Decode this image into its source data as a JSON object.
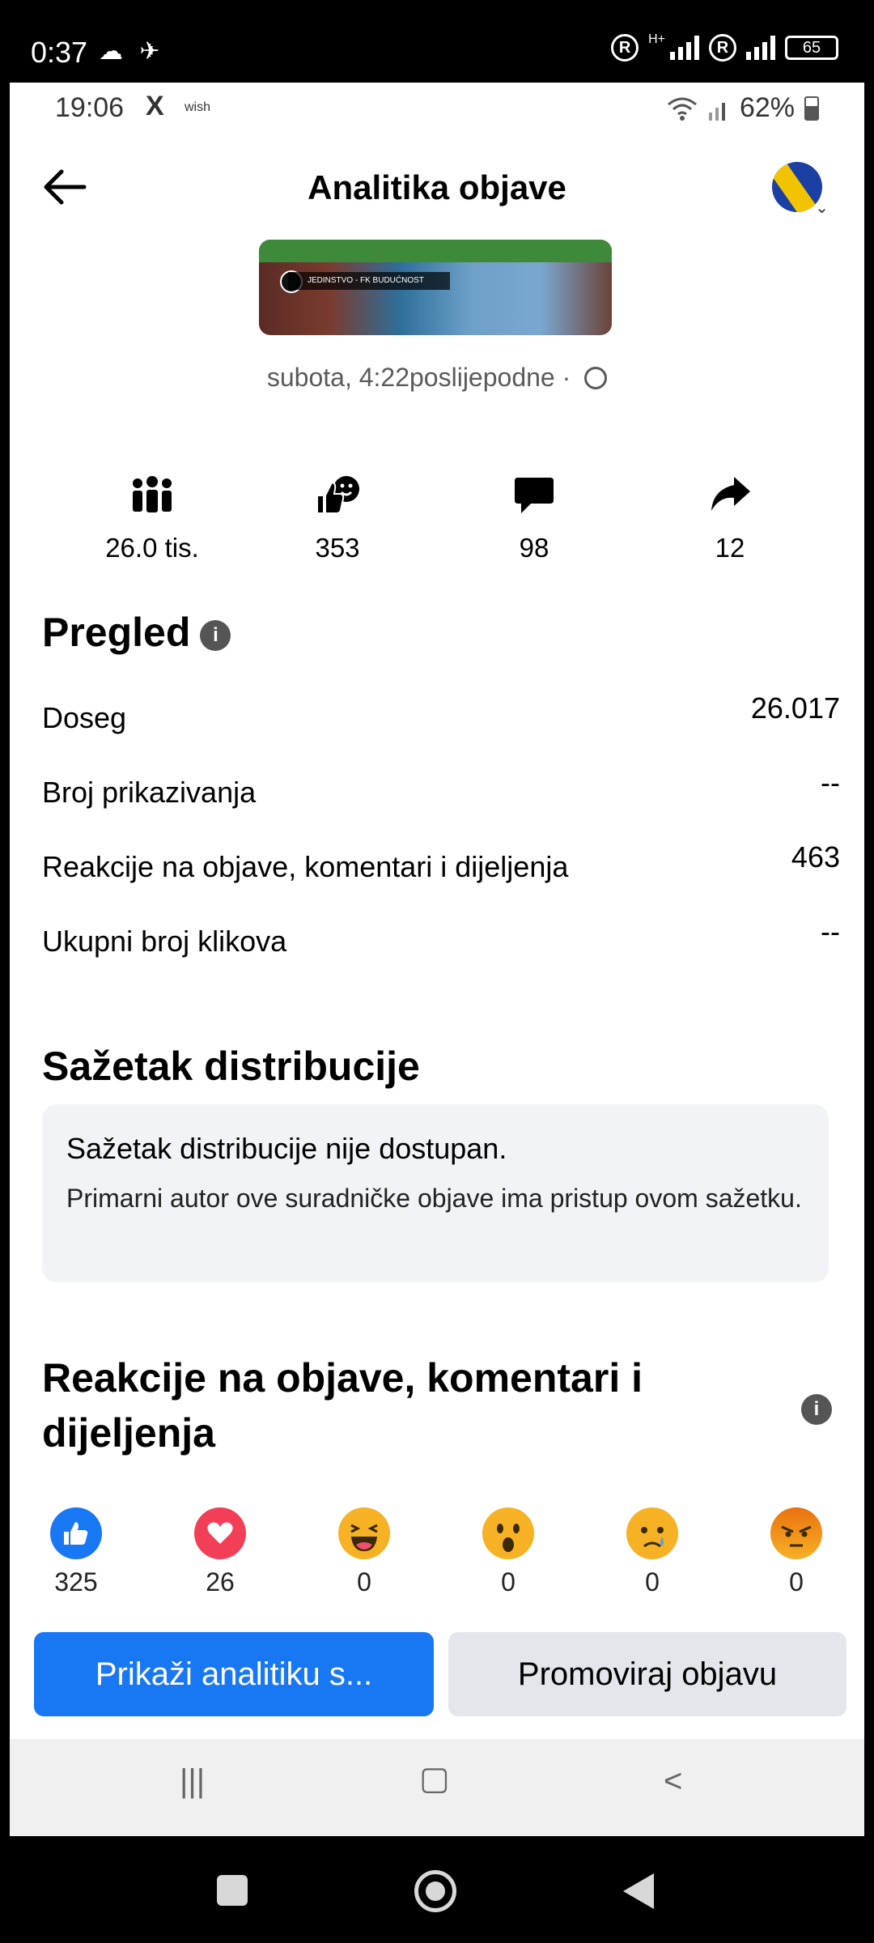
{
  "outer_status": {
    "time": "0:37",
    "battery": "65",
    "network": "H+"
  },
  "inner_status": {
    "time": "19:06",
    "x_label": "X",
    "wish_label": "wish",
    "battery": "62%"
  },
  "header": {
    "title": "Analitika objave"
  },
  "thumbnail": {
    "caption": "JEDINSTVO - FK BUDUĆNOST"
  },
  "post_meta": {
    "timestamp": "subota, 4:22poslijepodne ·"
  },
  "stats": [
    {
      "icon": "reach-people-icon",
      "value": "26.0 tis."
    },
    {
      "icon": "reactions-icon",
      "value": "353"
    },
    {
      "icon": "comment-icon",
      "value": "98"
    },
    {
      "icon": "share-icon",
      "value": "12"
    }
  ],
  "overview": {
    "title": "Pregled",
    "info": "i",
    "rows": [
      {
        "label": "Doseg",
        "value": "26.017"
      },
      {
        "label": "Broj prikazivanja",
        "value": "--"
      },
      {
        "label": "Reakcije na objave, komentari i dijeljenja",
        "value": "463"
      },
      {
        "label": "Ukupni broj klikova",
        "value": "--"
      }
    ]
  },
  "distribution": {
    "title": "Sažetak distribucije",
    "heading": "Sažetak distribucije nije dostupan.",
    "text": "Primarni autor ove suradničke objave ima pristup ovom sažetku."
  },
  "reactions_section": {
    "title": "Reakcije na objave, komentari i dijeljenja",
    "info": "i",
    "items": [
      {
        "icon": "like-icon",
        "count": "325",
        "color": "#1877f2"
      },
      {
        "icon": "love-icon",
        "count": "26",
        "color": "#f33e58"
      },
      {
        "icon": "haha-icon",
        "count": "0",
        "color": "#f7b125"
      },
      {
        "icon": "wow-icon",
        "count": "0",
        "color": "#f7b125"
      },
      {
        "icon": "sad-icon",
        "count": "0",
        "color": "#f7b125"
      },
      {
        "icon": "angry-icon",
        "count": "0",
        "color": "#e9710f"
      }
    ]
  },
  "buttons": {
    "primary": "Prikaži analitiku s...",
    "secondary": "Promoviraj objavu"
  },
  "colors": {
    "accent": "#1877f2",
    "secondary_button": "#e4e6eb",
    "box_bg": "#f1f3f6"
  }
}
